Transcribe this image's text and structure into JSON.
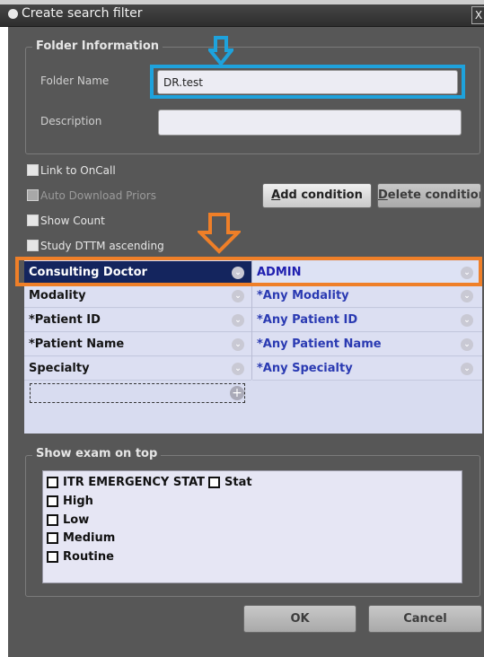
{
  "window": {
    "title": "Create search filter",
    "close_label": "X"
  },
  "folder_info": {
    "legend": "Folder Information",
    "folder_name_label": "Folder Name",
    "folder_name_value": "DR.test",
    "description_label": "Description",
    "description_value": ""
  },
  "options": [
    {
      "label": "Link to OnCall",
      "checked": false,
      "enabled": true
    },
    {
      "label": "Auto Download Priors",
      "checked": false,
      "enabled": false
    },
    {
      "label": "Show Count",
      "checked": false,
      "enabled": true
    },
    {
      "label": "Study DTTM ascending",
      "checked": false,
      "enabled": true
    }
  ],
  "buttons": {
    "add_condition_u": "A",
    "add_condition_rest": "dd condition",
    "delete_condition_u": "D",
    "delete_condition_rest": "elete condition",
    "ok": "OK",
    "cancel": "Cancel"
  },
  "conditions": [
    {
      "field": "Consulting Doctor",
      "value": "ADMIN",
      "selected": true
    },
    {
      "field": "Modality",
      "value": "*Any Modality",
      "selected": false
    },
    {
      "field": "*Patient ID",
      "value": "*Any Patient ID",
      "selected": false
    },
    {
      "field": "*Patient Name",
      "value": "*Any Patient Name",
      "selected": false
    },
    {
      "field": "Specialty",
      "value": "*Any Specialty",
      "selected": false
    }
  ],
  "show_exam": {
    "legend": "Show exam on top",
    "items": [
      {
        "label": "ITR EMERGENCY STAT",
        "checked": false
      },
      {
        "label": "Stat",
        "checked": false
      },
      {
        "label": "High",
        "checked": false
      },
      {
        "label": "Low",
        "checked": false
      },
      {
        "label": "Medium",
        "checked": false
      },
      {
        "label": "Routine",
        "checked": false
      }
    ]
  },
  "annotation_colors": {
    "blue_highlight": "#1ea2dc",
    "orange_highlight": "#ef7f28"
  }
}
